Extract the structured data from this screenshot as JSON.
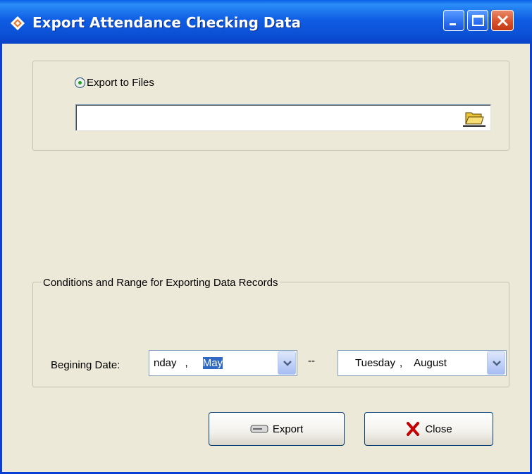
{
  "window": {
    "title": "Export Attendance Checking Data",
    "accent_color": "#0a50d4",
    "controls": [
      "minimize",
      "maximize",
      "close"
    ]
  },
  "export_target": {
    "option_label": "Export to Files",
    "selected": true,
    "file_path_value": "",
    "browse_icon": "folder-open-icon"
  },
  "range": {
    "group_title": "Conditions and Range for Exporting Data Records",
    "begin_label": "Begining Date:",
    "begin_date": {
      "day_fragment": "nday",
      "separator": ",",
      "month": "May"
    },
    "range_separator": "--",
    "end_date": {
      "weekday": "Tuesday",
      "separator": ",",
      "month": "August"
    }
  },
  "buttons": {
    "export_label": "Export",
    "close_label": "Close"
  }
}
